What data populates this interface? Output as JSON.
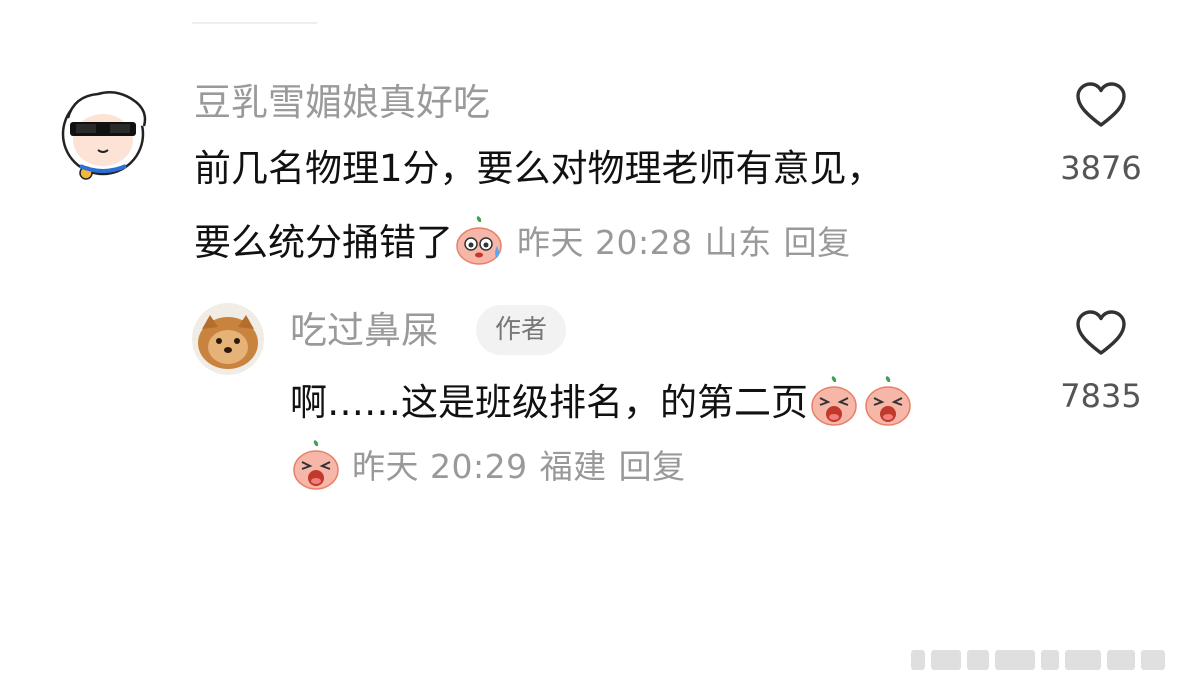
{
  "comments": [
    {
      "username": "豆乳雪媚娘真好吃",
      "lines": [
        "前几名物理1分，要么对物理老师有意见，",
        "要么统分捅错了"
      ],
      "time": "昨天 20:28",
      "location": "山东",
      "reply_label": "回复",
      "likes": "3876",
      "avatar_icon": "cartoon-sheep-with-sunglasses-avatar",
      "emoji": [
        "sweat-peach-emoji"
      ]
    },
    {
      "username": "吃过鼻屎",
      "badge": "作者",
      "lines": [
        "啊……这是班级排名，的第二页"
      ],
      "time": "昨天 20:29",
      "location": "福建",
      "reply_label": "回复",
      "likes": "7835",
      "avatar_icon": "shiba-dog-toast-avatar",
      "emoji": [
        "crying-peach-emoji",
        "crying-peach-emoji",
        "crying-peach-emoji"
      ]
    }
  ],
  "icons": {
    "like": "heart-outline-icon"
  }
}
